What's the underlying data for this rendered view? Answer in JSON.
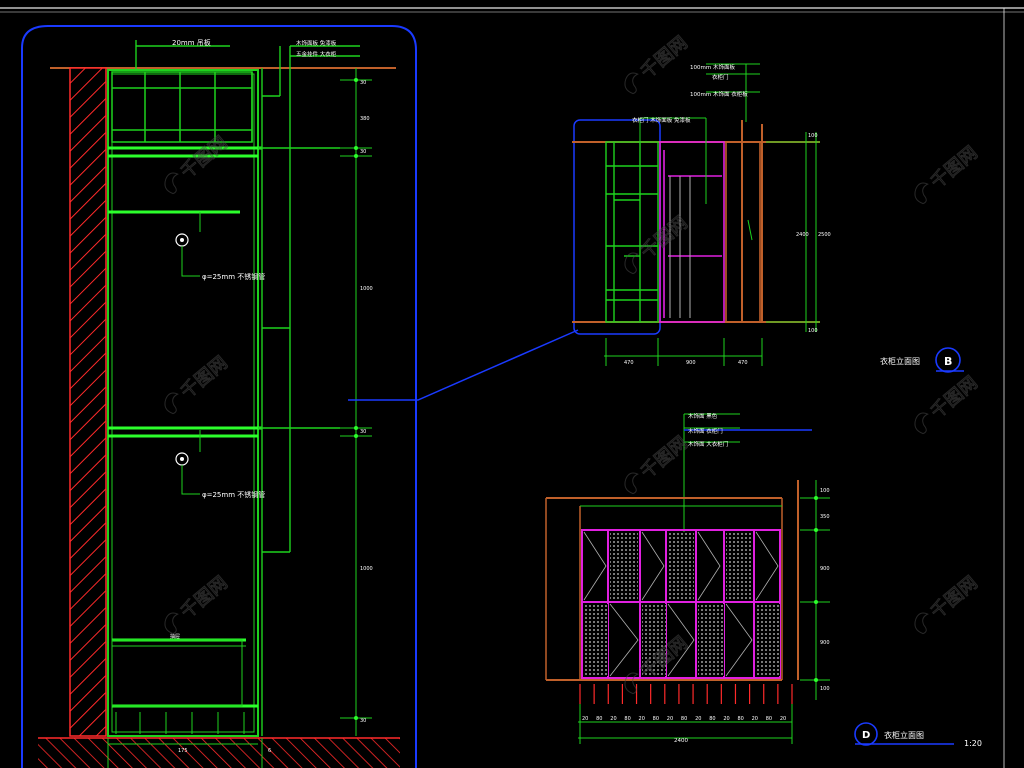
{
  "colors": {
    "background": "#000000",
    "green": "#1ed21e",
    "bright_green": "#2cff2c",
    "magenta": "#e020e0",
    "red": "#ff2a2a",
    "blue": "#1a3aff",
    "orange_brown": "#c0602a",
    "white": "#ffffff",
    "gray_grid": "#b0b0b0"
  },
  "watermark": {
    "text": "千图网",
    "brand_icon": "qiantu-logo-icon"
  },
  "left_section": {
    "top_note": "20mm 吊板",
    "right_notes": [
      "木饰面板 免漆板",
      "五金挂件 大衣柜"
    ],
    "dim_values_right": [
      "30",
      "380",
      "30",
      "1000",
      "30",
      "1000",
      "30"
    ],
    "rod_note_1": "φ=25mm 不锈钢管",
    "rod_note_2": "φ=25mm 不锈钢管",
    "drawer_note": "抽屉",
    "bottom_dims": [
      "175",
      "6"
    ]
  },
  "elevation_b": {
    "notes": [
      "100mm 木饰面板",
      "衣柜门",
      "100mm 木饰面 衣柜板"
    ],
    "mid_note": "衣柜门 木饰面板 免漆板",
    "dims_right": [
      "100",
      "2400",
      "2500",
      "100"
    ],
    "dims_bottom": [
      "470",
      "900",
      "470"
    ],
    "title": "衣柜立面图",
    "tag": "B"
  },
  "elevation_d": {
    "notes": [
      "木饰面 黑色",
      "木饰面 衣柜门",
      "木饰面 大衣柜门"
    ],
    "dims_right": [
      "100",
      "350",
      "900",
      "900",
      "100"
    ],
    "dims_bottom": [
      "20",
      "80",
      "20",
      "80",
      "20",
      "80",
      "20",
      "80",
      "20",
      "80",
      "20",
      "80",
      "20",
      "80",
      "20"
    ],
    "total_dim": "2400",
    "title": "衣柜立面图",
    "tag": "D",
    "scale": "1:20"
  }
}
